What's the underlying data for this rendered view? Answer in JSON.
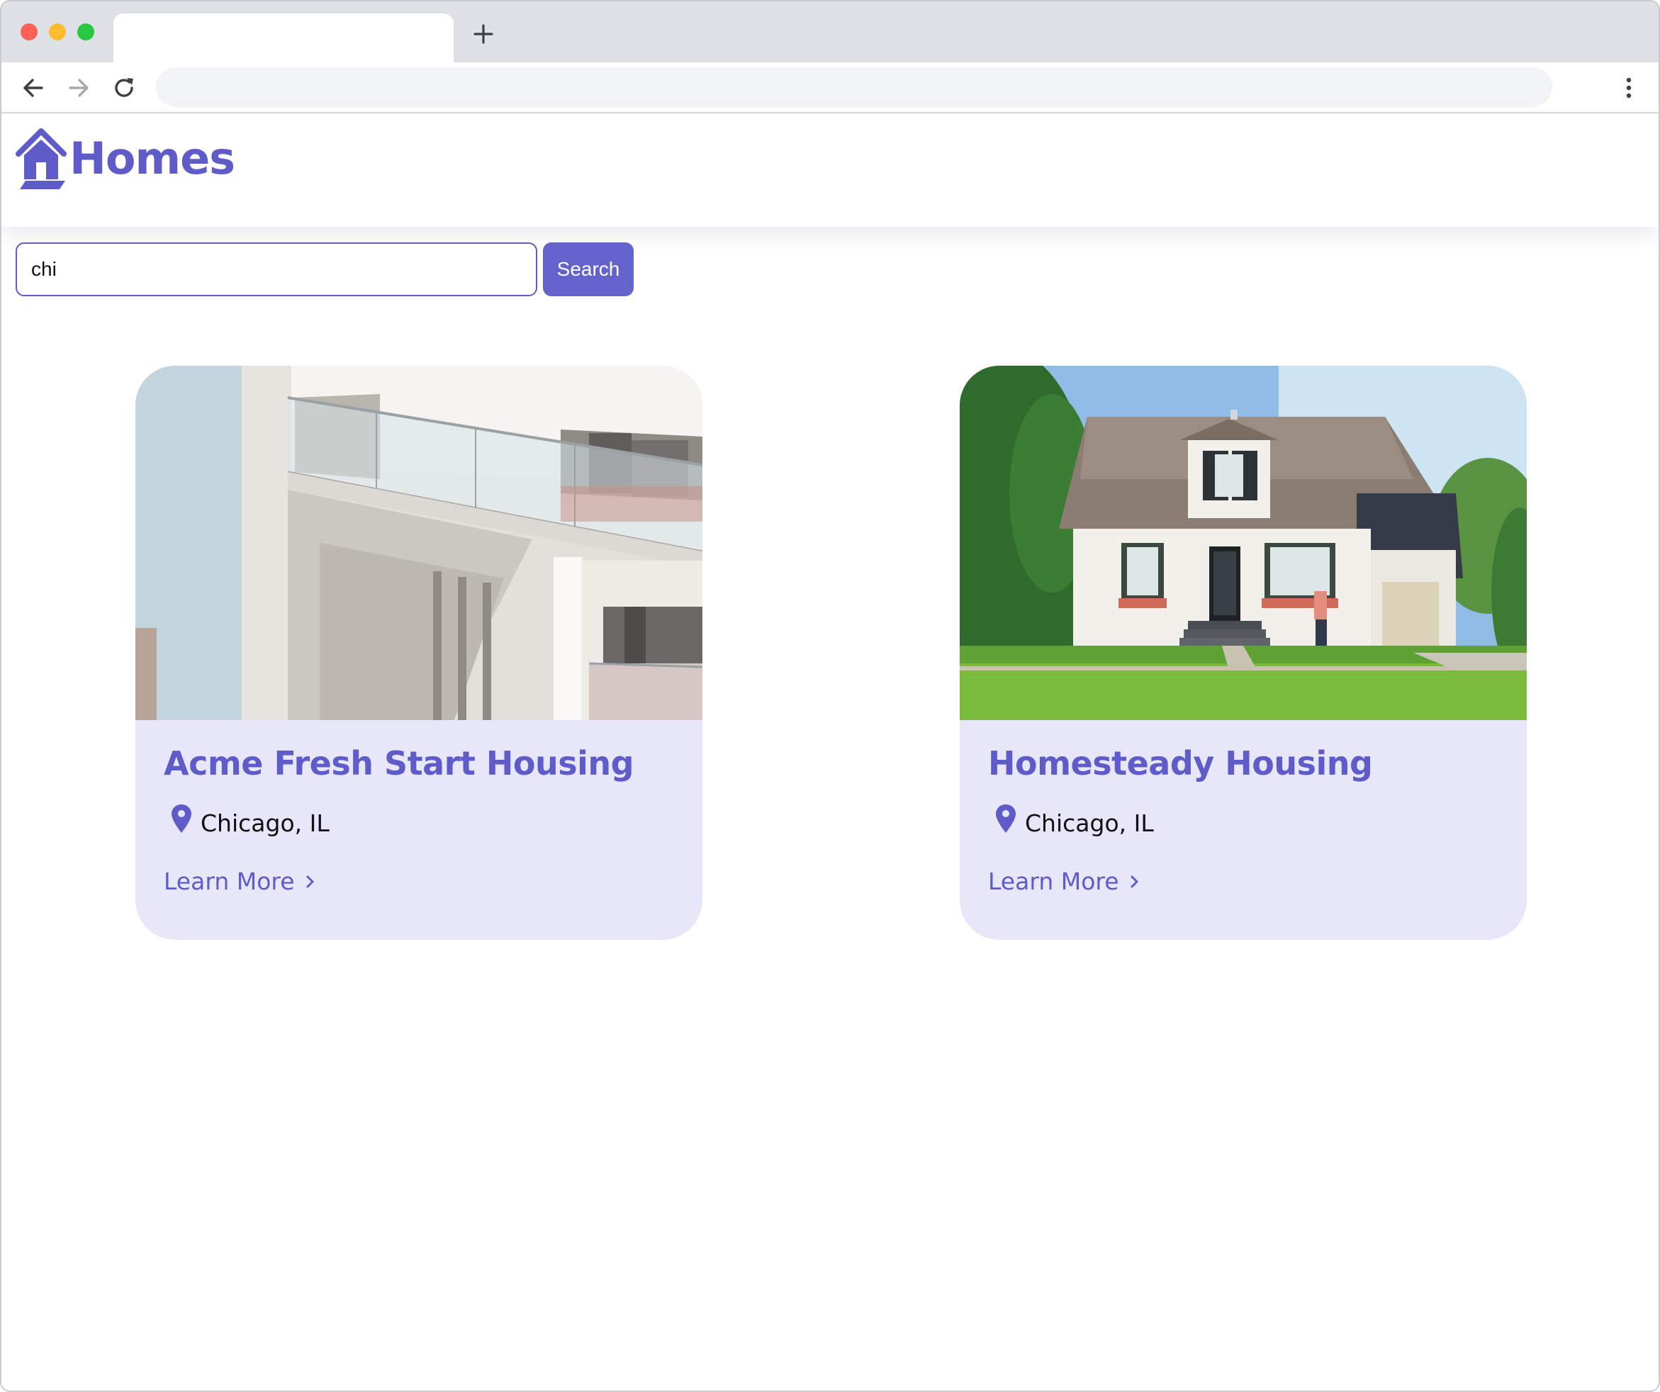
{
  "browser": {
    "tab_title": "",
    "address_value": ""
  },
  "site": {
    "brand": "Homes",
    "accent_color": "#5f5bc9",
    "card_background": "#e8e6f9"
  },
  "search": {
    "value": "chi",
    "placeholder": "",
    "button_label": "Search"
  },
  "listings": [
    {
      "name": "Acme Fresh Start Housing",
      "location": "Chicago, IL",
      "link_label": "Learn More"
    },
    {
      "name": "Homesteady Housing",
      "location": "Chicago, IL",
      "link_label": "Learn More"
    }
  ],
  "icons": {
    "logo": "house-icon",
    "location": "map-pin-icon",
    "link": "chevron-right-icon",
    "back": "arrow-left-icon",
    "forward": "arrow-right-icon",
    "reload": "reload-icon",
    "menu": "kebab-menu-icon",
    "new_tab": "plus-icon"
  }
}
